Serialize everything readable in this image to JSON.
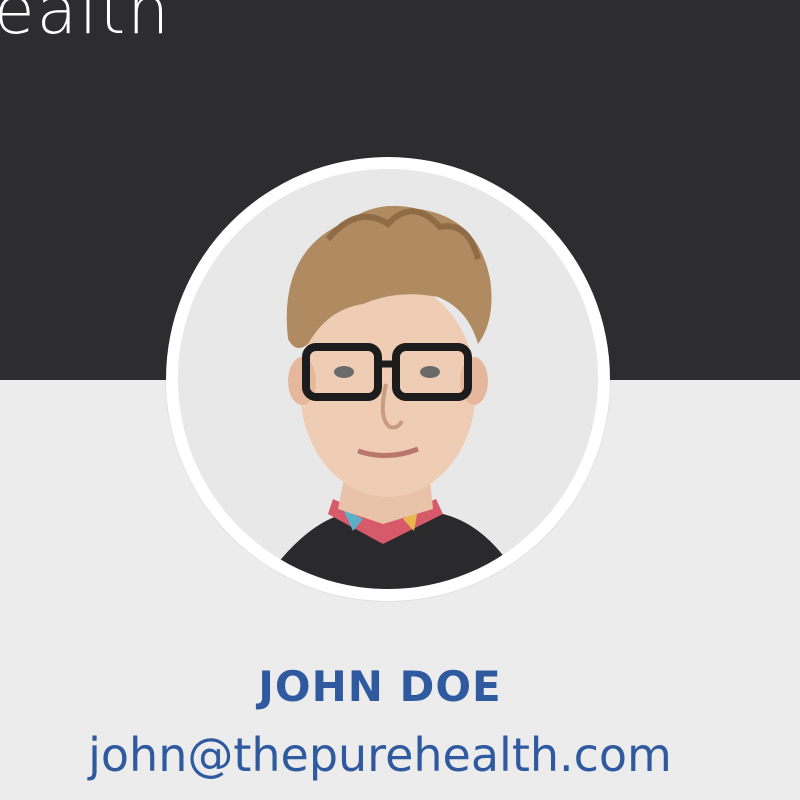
{
  "header": {
    "logo_text": "ealth",
    "background_color": "#2d2c2e"
  },
  "profile": {
    "name": "JOHN DOE",
    "email": "john@thepurehealth.com",
    "accent_color": "#2f5aa0",
    "avatar_icon": "profile-photo"
  },
  "page": {
    "background_color": "#ececec"
  }
}
